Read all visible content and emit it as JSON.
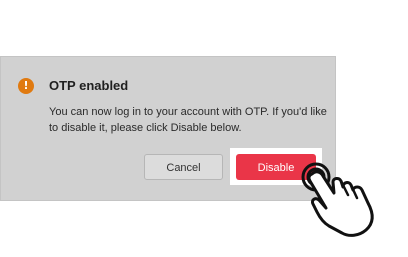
{
  "dialog": {
    "icon": "warning-icon",
    "icon_glyph": "!",
    "title": "OTP enabled",
    "message": "You can now log in to your account with OTP. If you'd like to disable it, please click Disable below.",
    "cancel_label": "Cancel",
    "disable_label": "Disable"
  },
  "colors": {
    "dialog_background": "#d1d1d1",
    "warning_icon": "#e07a10",
    "disable_button": "#ea3548",
    "cancel_button": "#dcdcdc"
  },
  "cursor": {
    "icon": "hand-pointer-icon"
  }
}
